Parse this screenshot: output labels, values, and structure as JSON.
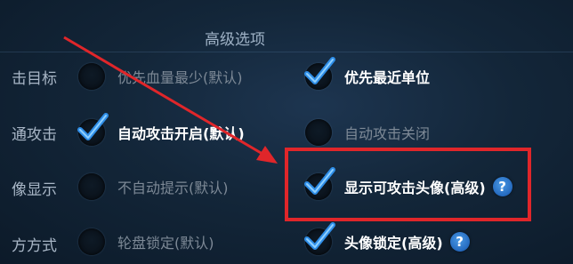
{
  "section_title": "高级选项",
  "rows": [
    {
      "label": "击目标",
      "options": [
        {
          "label": "优先血量最少(默认)",
          "selected": false
        },
        {
          "label": "优先最近单位",
          "selected": true
        }
      ]
    },
    {
      "label": "通攻击",
      "options": [
        {
          "label": "自动攻击开启(默认)",
          "selected": true
        },
        {
          "label": "自动攻击关闭",
          "selected": false
        }
      ]
    },
    {
      "label": "像显示",
      "options": [
        {
          "label": "不自动提示(默认)",
          "selected": false
        },
        {
          "label": "显示可攻击头像(高级)",
          "selected": true,
          "help": "?"
        }
      ]
    },
    {
      "label": "方方式",
      "options": [
        {
          "label": "轮盘锁定(默认)",
          "selected": false
        },
        {
          "label": "头像锁定(高级)",
          "selected": true,
          "help": "?"
        }
      ]
    }
  ],
  "colors": {
    "annotation": "#e0262a",
    "check": "#2f8ee8",
    "help": "#2a72c9"
  }
}
